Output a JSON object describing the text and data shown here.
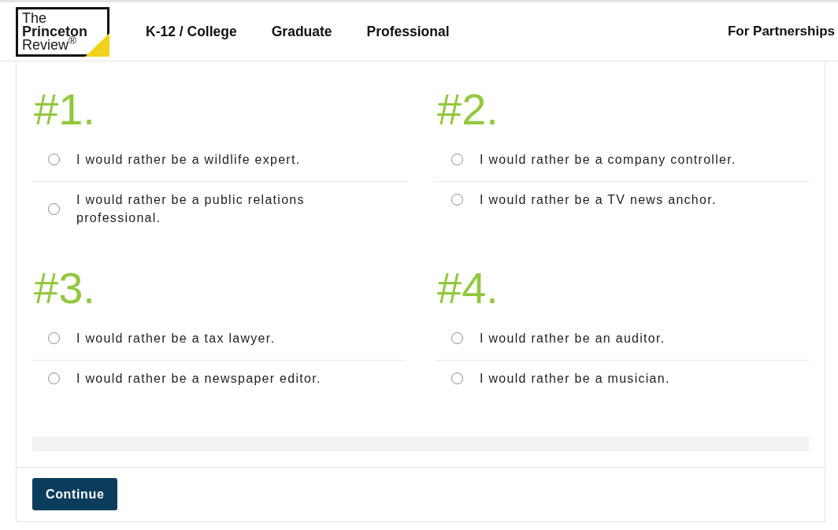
{
  "header": {
    "logo": {
      "lines": [
        {
          "text": "The",
          "bold": false
        },
        {
          "text": "Princeton",
          "bold": true
        },
        {
          "text": "Review$^{®}$",
          "bold": false
        }
      ]
    },
    "nav": [
      "K-12 / College",
      "Graduate",
      "Professional"
    ],
    "right_link": "For Partnerships"
  },
  "questions": [
    {
      "number": "#1.",
      "options": [
        {
          "text": "I would rather be a wildlife expert.",
          "selected": false
        },
        {
          "text": "I would rather be a public relations professional.",
          "selected": false
        }
      ]
    },
    {
      "number": "#2.",
      "options": [
        {
          "text": "I would rather be a company controller.",
          "selected": false
        },
        {
          "text": "I would rather be a TV news anchor.",
          "selected": false
        }
      ]
    },
    {
      "number": "#3.",
      "options": [
        {
          "text": "I would rather be a tax lawyer.",
          "selected": false
        },
        {
          "text": "I would rather be a newspaper editor.",
          "selected": false
        }
      ]
    },
    {
      "number": "#4.",
      "options": [
        {
          "text": "I would rather be an auditor.",
          "selected": false
        },
        {
          "text": "I would rather be a musician.",
          "selected": false
        }
      ]
    }
  ],
  "continue_button": "Continue"
}
